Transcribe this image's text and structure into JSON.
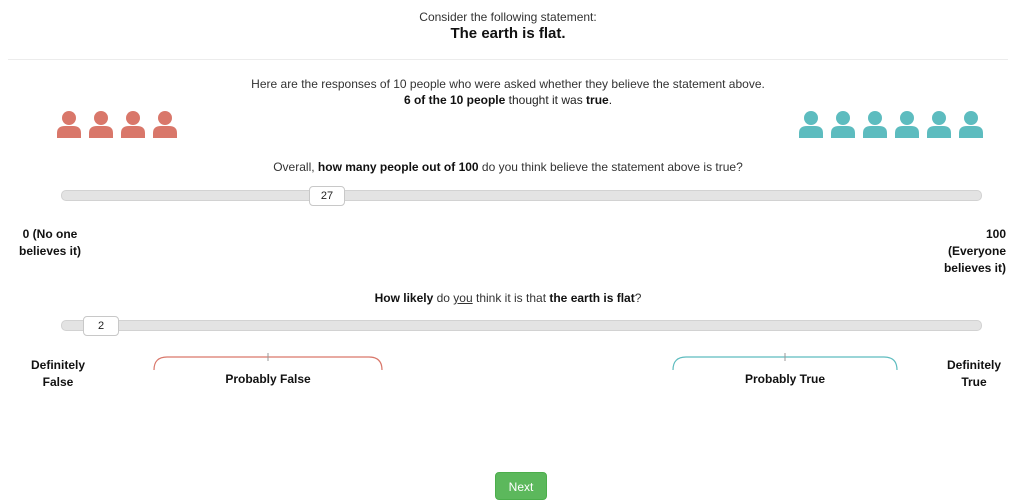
{
  "intro": {
    "text": "Consider the following statement:"
  },
  "statement": {
    "text": "The earth is flat."
  },
  "responses": {
    "line1": "Here are the responses of 10 people who were asked whether they believe the statement above.",
    "count_bold": "6 of the 10 people",
    "thought_text": " thought it was ",
    "true_word": "true",
    "period": ".",
    "false_count": 4,
    "true_count": 6,
    "false_color": "#d9776a",
    "true_color": "#5dbcbf"
  },
  "question1": {
    "prefix": "Overall, ",
    "bold": "how many people out of 100",
    "suffix": " do you think believe the statement above is true?",
    "value": "27",
    "left_label_1": "0 (No one",
    "left_label_2": "believes it)",
    "right_label_1": "100",
    "right_label_2": "(Everyone",
    "right_label_3": "believes it)"
  },
  "question2": {
    "bold1": "How likely",
    "text1": " do ",
    "you": "you",
    "text2": " think it is that ",
    "bold2": "the earth is flat",
    "qmark": "?",
    "value": "2",
    "left_label_1": "Definitely",
    "left_label_2": "False",
    "right_label_1": "Definitely",
    "right_label_2": "True",
    "probably_false": "Probably False",
    "probably_true": "Probably True"
  },
  "next_button": {
    "label": "Next",
    "color": "#5cb85c"
  }
}
